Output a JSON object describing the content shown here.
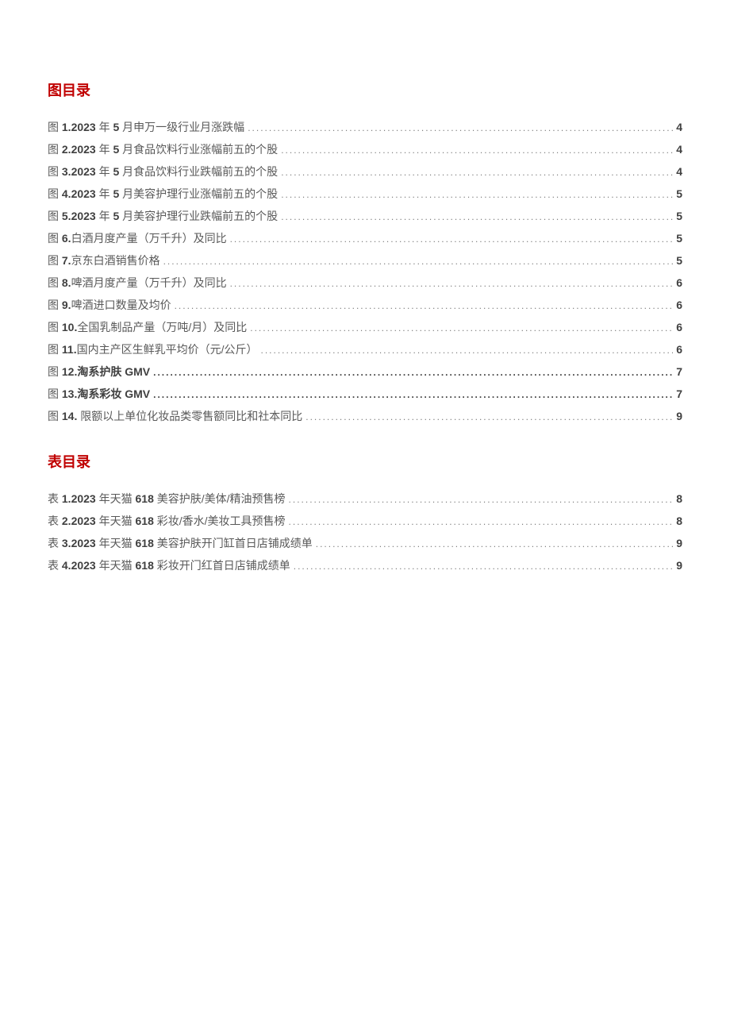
{
  "sections": {
    "figures": {
      "title": "图目录",
      "items": [
        {
          "prefix": "图 ",
          "num": "1.2023",
          "mid1": " 年 ",
          "mid2": "5",
          "text": " 月申万一级行业月涨跌幅",
          "page": "4",
          "bold_line": false
        },
        {
          "prefix": "图 ",
          "num": "2.2023",
          "mid1": " 年 ",
          "mid2": "5",
          "text": " 月食品饮料行业涨幅前五的个股 ",
          "page": "4",
          "bold_line": false
        },
        {
          "prefix": "图 ",
          "num": "3.2023",
          "mid1": " 年 ",
          "mid2": "5",
          "text": " 月食品饮料行业跌幅前五的个股",
          "page": "4",
          "bold_line": false
        },
        {
          "prefix": "图 ",
          "num": "4.2023",
          "mid1": " 年 ",
          "mid2": "5",
          "text": " 月美容护理行业涨幅前五的个股",
          "page": "5",
          "bold_line": false
        },
        {
          "prefix": "图 ",
          "num": "5.2023",
          "mid1": " 年 ",
          "mid2": "5",
          "text": " 月美容护理行业跌幅前五的个股",
          "page": "5",
          "bold_line": false
        },
        {
          "prefix": "图 ",
          "num": "6.",
          "mid1": "",
          "mid2": "",
          "text": "白酒月度产量（万千升）及同比",
          "page": "5",
          "bold_line": false
        },
        {
          "prefix": "图 ",
          "num": "7.",
          "mid1": "",
          "mid2": "",
          "text": "京东白酒销售价格",
          "page": "5",
          "bold_line": false
        },
        {
          "prefix": "图 ",
          "num": "8.",
          "mid1": "",
          "mid2": "",
          "text": "啤酒月度产量（万千升）及同比",
          "page": "6",
          "bold_line": false
        },
        {
          "prefix": "图 ",
          "num": "9.",
          "mid1": "",
          "mid2": "",
          "text": "啤酒进口数量及均价",
          "page": "6",
          "bold_line": false
        },
        {
          "prefix": "图 ",
          "num": "10.",
          "mid1": "",
          "mid2": "",
          "text": "全国乳制品产量（万吨/月）及同比",
          "page": "6",
          "bold_line": false
        },
        {
          "prefix": "图 ",
          "num": "11.",
          "mid1": "",
          "mid2": "",
          "text": "国内主产区生鲜乳平均价（元/公斤）",
          "page": "6",
          "bold_line": false
        },
        {
          "prefix": "图 ",
          "num": "12.",
          "mid1": "",
          "mid2": "",
          "text": "淘系护肤 GMV ",
          "page": "7",
          "bold_line": true
        },
        {
          "prefix": "图 ",
          "num": "13.",
          "mid1": "",
          "mid2": "",
          "text": "淘系彩妆 GMV ",
          "page": "7",
          "bold_line": true
        },
        {
          "prefix": "图 ",
          "num": "14.",
          "mid1": " ",
          "mid2": "",
          "text": "限额以上单位化妆品类零售额同比和社本同比 ",
          "page": "9",
          "bold_line": false
        }
      ]
    },
    "tables": {
      "title": "表目录",
      "items": [
        {
          "prefix": "表 ",
          "num": "1.2023",
          "mid1": " 年天猫 ",
          "mid2": "618",
          "text": " 美容护肤/美体/精油预售榜 ",
          "page": "8",
          "bold_line": false
        },
        {
          "prefix": "表 ",
          "num": "2.2023",
          "mid1": " 年天猫 ",
          "mid2": "618",
          "text": " 彩妆/香水/美妆工具预售榜 ",
          "page": "8",
          "bold_line": false
        },
        {
          "prefix": "表 ",
          "num": "3.2023",
          "mid1": " 年天猫 ",
          "mid2": "618",
          "text": " 美容护肤开门缸首日店铺成绩单 ",
          "page": "9",
          "bold_line": false
        },
        {
          "prefix": "表 ",
          "num": "4.2023",
          "mid1": " 年天猫 ",
          "mid2": "618",
          "text": " 彩妆开门红首日店铺成绩单",
          "page": "9",
          "bold_line": false
        }
      ]
    }
  },
  "dots": "...................................................................................................................................................."
}
